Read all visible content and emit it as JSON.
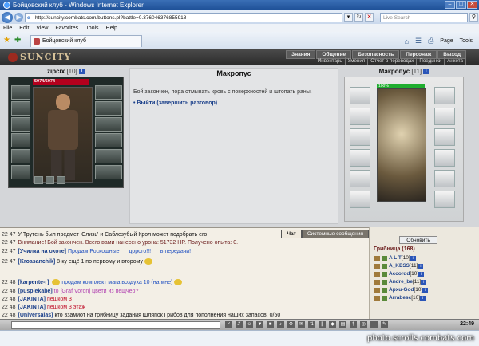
{
  "window": {
    "title": "Бойцовский клуб - Windows Internet Explorer"
  },
  "address": {
    "url": "http://suncity.combats.com/buttons.pl?battle=0.376046376855918",
    "search_placeholder": "Live Search"
  },
  "menu": [
    "File",
    "Edit",
    "View",
    "Favorites",
    "Tools",
    "Help"
  ],
  "tab": {
    "label": "Бойцовский клуб"
  },
  "ie_tools": {
    "page": "Page",
    "tools": "Tools"
  },
  "game": {
    "logo": "SUNCITY",
    "nav_top": [
      "Знания",
      "Общение",
      "Безопасность",
      "Персонаж",
      "Выход"
    ],
    "nav_bottom": [
      "Инвентарь",
      "Умения",
      "Отчет о переводах",
      "Поединки",
      "Анкета"
    ]
  },
  "player": {
    "name": "zipcix",
    "level": "[10]",
    "hp": "5074/5074"
  },
  "dialog": {
    "npc": "Макропус",
    "message": "Бой закончен, пора отмывать кровь с поверхностей и штопать раны.",
    "exit_link": "• Выйти (завершить разговор)"
  },
  "opponent": {
    "name": "Макропус",
    "level": "[11]",
    "hp": "100%"
  },
  "chat": {
    "tabs": [
      "Чат",
      "Системные сообщения"
    ],
    "lines": [
      {
        "time": "22 47",
        "user": "",
        "text": "У Трутень был предмет 'Слизь' и Саблезубый Крол может подобрать его"
      },
      {
        "time": "22 47",
        "user": "",
        "text": "Внимание! Бой закончен. Всего вами нанесено урона: 51732 HP. Получено опыта: 0."
      },
      {
        "time": "22 47",
        "user": "[Училка на охоте]",
        "text": "Продам Роскошные___дорого!!!___в передачи!"
      },
      {
        "time": "22 47",
        "user": "[Kroasanchik]",
        "text": "8-ку ещё 1 по первому и второму"
      },
      {
        "time": "22 48",
        "user": "[karpente-r]",
        "text": "продам комплект мага воздуха 10 (на мне)"
      },
      {
        "time": "22 48",
        "user": "[puspiekabe]",
        "text": "to [Graf Voron] цвети из пещчер?"
      },
      {
        "time": "22 48",
        "user": "[JAKINTA]",
        "text": "пешком 3"
      },
      {
        "time": "22 48",
        "user": "[JAKINTA]",
        "text": "пешком 3 этаж"
      },
      {
        "time": "22 48",
        "user": "[Universalas]",
        "text": "кто взамиот на грибницу задания Шляпок Грибов для пополнения наших запасов. 0/50"
      }
    ]
  },
  "userlist": {
    "refresh": "Обновить",
    "location": "Грибница (168)",
    "users": [
      {
        "name": "A L T",
        "level": "[10]"
      },
      {
        "name": "A_KESS",
        "level": "[11]"
      },
      {
        "name": "Accordd",
        "level": "[10]"
      },
      {
        "name": "Andre_be",
        "level": "[11]"
      },
      {
        "name": "Apxu-God",
        "level": "[10]"
      },
      {
        "name": "Arrabesc",
        "level": "[10]"
      }
    ]
  },
  "clock": "22:49",
  "watermark": "photo.scrolls.combats.com"
}
